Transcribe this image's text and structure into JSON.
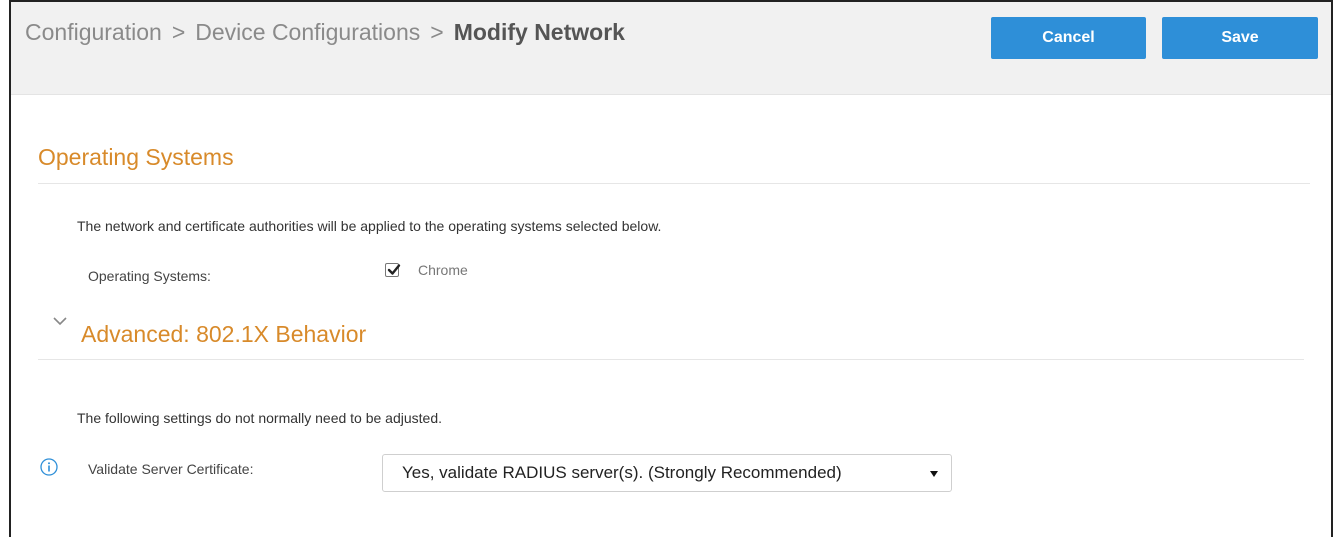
{
  "header": {
    "breadcrumb": [
      {
        "label": "Configuration"
      },
      {
        "label": "Device Configurations"
      },
      {
        "label": "Modify Network"
      }
    ],
    "separator": ">",
    "cancel_label": "Cancel",
    "save_label": "Save"
  },
  "operating_systems": {
    "title": "Operating Systems",
    "description": "The network and certificate authorities will be applied to the operating systems selected below.",
    "field_label": "Operating Systems:",
    "options": [
      {
        "label": "Chrome",
        "checked": true
      }
    ]
  },
  "advanced": {
    "title": "Advanced: 802.1X Behavior",
    "expanded": true,
    "description": "The following settings do not normally need to be adjusted.",
    "validate_label": "Validate Server Certificate:",
    "validate_value": "Yes, validate RADIUS server(s). (Strongly Recommended)"
  },
  "icons": {
    "chevron": "chevron-down-icon",
    "info": "info-icon",
    "dropdown": "dropdown-arrow-icon",
    "check": "checkmark-icon"
  },
  "colors": {
    "accent_button": "#2e8fd8",
    "section_title": "#d88a2a",
    "header_bg": "#f1f1f1"
  }
}
